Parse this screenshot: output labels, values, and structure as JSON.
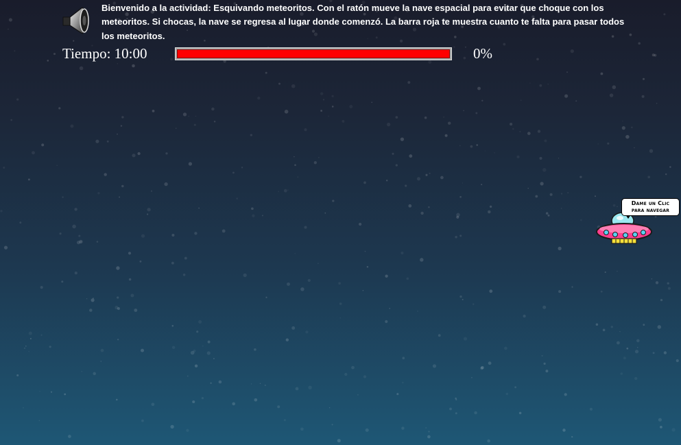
{
  "game": {
    "intro_text": "Bienvenido a la actividad: Esquivando meteoritos. Con el ratón mueve la nave espacial para evitar que choque con los meteoritos. Si chocas, la nave se regresa al lugar donde comenzó. La barra roja te muestra cuanto te falta para pasar todos los meteoritos.",
    "audio_icon": "speaker-icon",
    "timer_text": "Tiempo: 10:00",
    "progress_fraction": 1.0,
    "percent_text": "0%"
  },
  "nav_button": {
    "line1": "Dame un Clic",
    "line2": "para navegar",
    "icon": "ufo-icon"
  },
  "colors": {
    "progress_bar": "#ff0000",
    "background_top": "#191c2b",
    "background_bottom": "#1e5775",
    "ufo_body": "#ff3f8e"
  }
}
